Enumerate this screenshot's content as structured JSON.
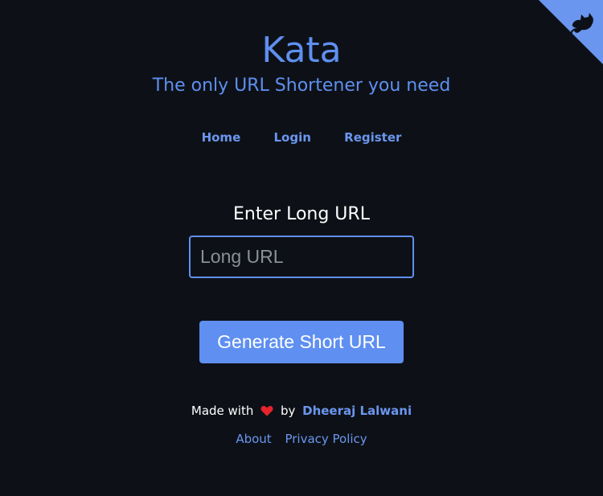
{
  "header": {
    "title": "Kata",
    "subtitle": "The only URL Shortener you need"
  },
  "nav": {
    "items": [
      "Home",
      "Login",
      "Register"
    ]
  },
  "form": {
    "label": "Enter Long URL",
    "input_placeholder": "Long URL",
    "input_value": "",
    "button_label": "Generate Short URL"
  },
  "footer": {
    "made_with": "Made with",
    "by": "by",
    "author": "Dheeraj Lalwani",
    "links": [
      "About",
      "Privacy Policy"
    ]
  },
  "icons": {
    "corner": "github-corner-icon",
    "heart": "heart-icon"
  },
  "colors": {
    "background": "#0d1117",
    "accent": "#5f8ff0",
    "heart": "#e5242b"
  }
}
